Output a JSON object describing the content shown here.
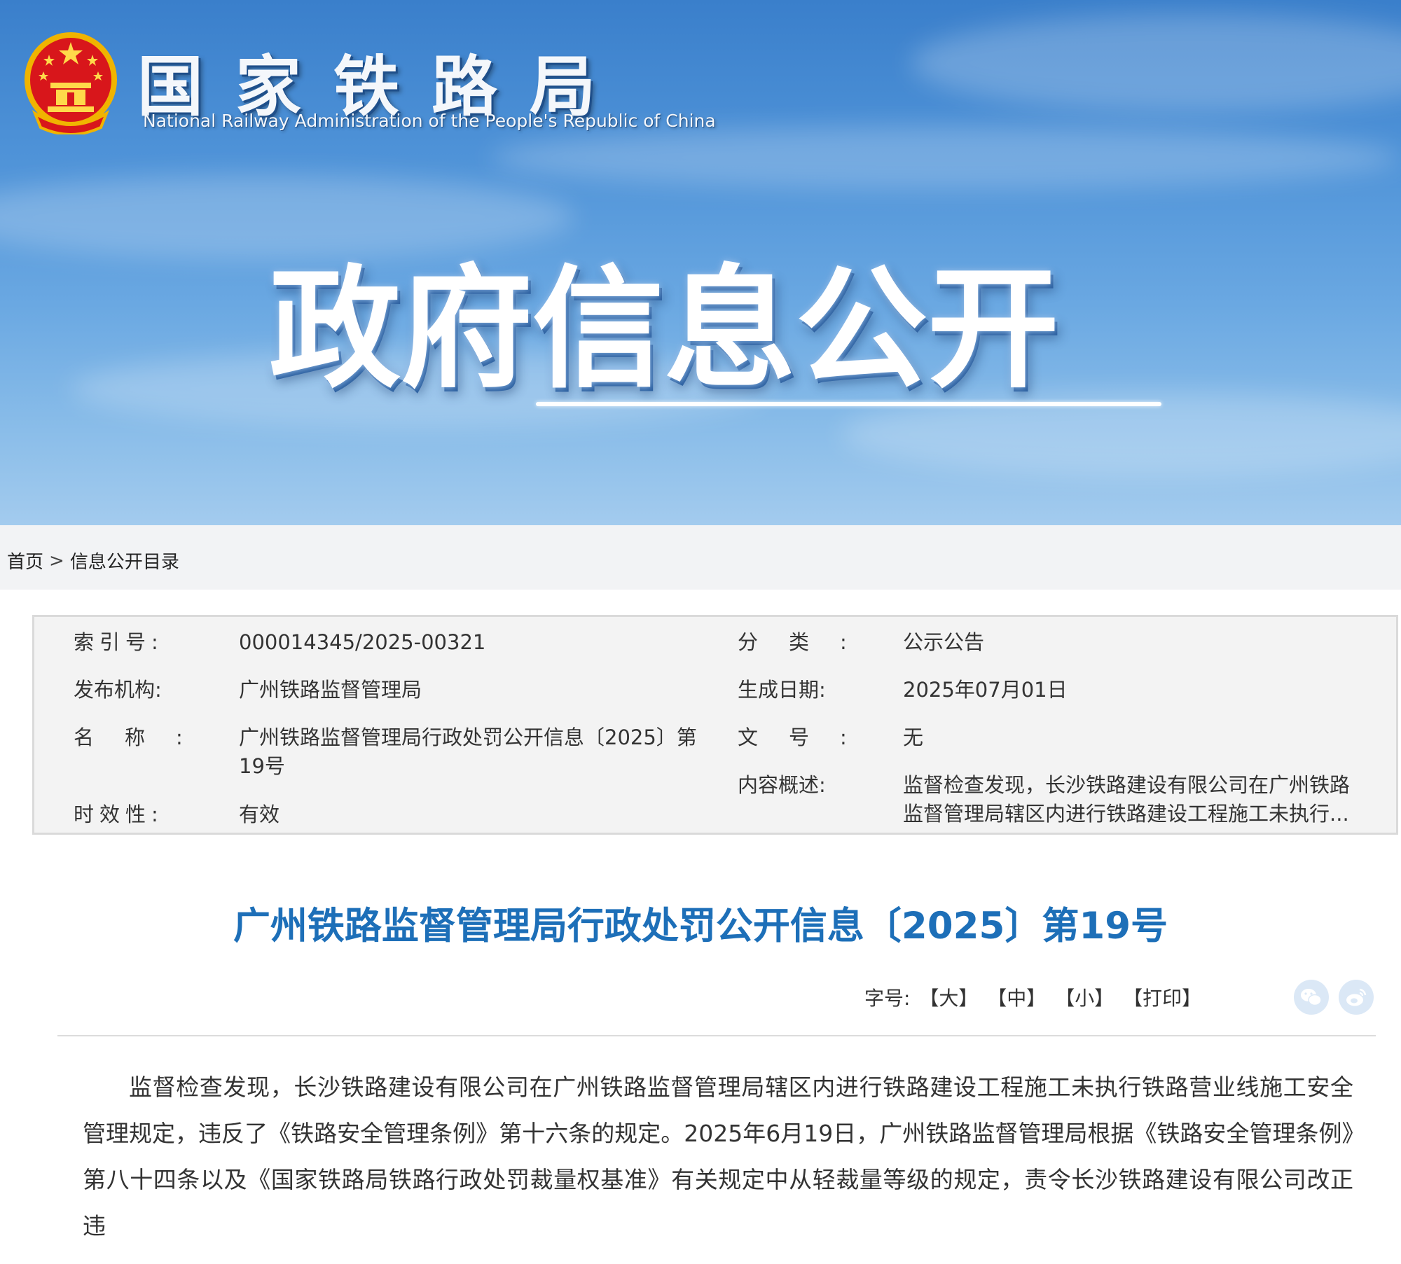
{
  "header": {
    "org_name_cn": "国家铁路局",
    "org_name_en": "National Railway Administration of the People's Republic of China",
    "banner_title": "政府信息公开"
  },
  "breadcrumb": {
    "home": "首页",
    "separator": ">",
    "current": "信息公开目录"
  },
  "info": {
    "index_label": "索引号:",
    "index_value": "000014345/2025-00321",
    "category_label": "分类:",
    "category_value": "公示公告",
    "publisher_label": "发布机构:",
    "publisher_value": "广州铁路监督管理局",
    "date_label": "生成日期:",
    "date_value": "2025年07月01日",
    "name_label": "名称:",
    "name_value": "广州铁路监督管理局行政处罚公开信息〔2025〕第19号",
    "doc_no_label": "文号:",
    "doc_no_value": "无",
    "summary_label": "内容概述:",
    "summary_value": "监督检查发现，长沙铁路建设有限公司在广州铁路监督管理局辖区内进行铁路建设工程施工未执行...",
    "validity_label": "时效性:",
    "validity_value": "有效"
  },
  "article": {
    "title": "广州铁路监督管理局行政处罚公开信息〔2025〕第19号",
    "font_size_label": "字号:",
    "font_large": "【大】",
    "font_medium": "【中】",
    "font_small": "【小】",
    "print": "【打印】",
    "share_icons": [
      "wechat-icon",
      "weibo-icon"
    ],
    "body": "监督检查发现，长沙铁路建设有限公司在广州铁路监督管理局辖区内进行铁路建设工程施工未执行铁路营业线施工安全管理规定，违反了《铁路安全管理条例》第十六条的规定。2025年6月19日，广州铁路监督管理局根据《铁路安全管理条例》第八十四条以及《国家铁路局铁路行政处罚裁量权基准》有关规定中从轻裁量等级的规定，责令长沙铁路建设有限公司改正违"
  },
  "colors": {
    "title_blue": "#1d6fb8",
    "banner_blue": "#4f93d8",
    "table_bg": "#f3f3f3"
  }
}
